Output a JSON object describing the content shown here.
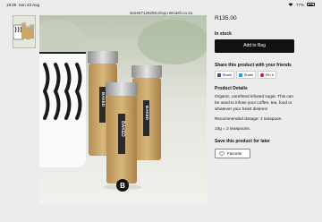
{
  "status_bar": {
    "time": "18:25",
    "date": "Sun 23 Aug",
    "battery": "77%"
  },
  "browser": {
    "url": "store67126258.shop.netcash.co.za"
  },
  "product": {
    "price": "R135.00",
    "stock_status": "In stock",
    "add_to_bag_label": "Add to Bag",
    "share_title": "Share this product with your friends",
    "share_buttons": [
      "Share",
      "Share",
      "Pin it"
    ],
    "details_title": "Product Details",
    "details": [
      "Organic, unrefined infused sugar. This can be used to infuse your coffee, tea, food or whatever your heart desires!",
      "Recommended dosage: 1 teaspoon.",
      "10g = 2 teaspoons."
    ],
    "save_title": "Save this product for later",
    "favorite_label": "Favorite"
  },
  "image": {
    "jar_label": "BAKED",
    "brand_letter": "B"
  },
  "colors": {
    "button_bg": "#111111",
    "facebook": "#3b5998",
    "twitter": "#1da1f2",
    "pinterest": "#cb2027"
  }
}
